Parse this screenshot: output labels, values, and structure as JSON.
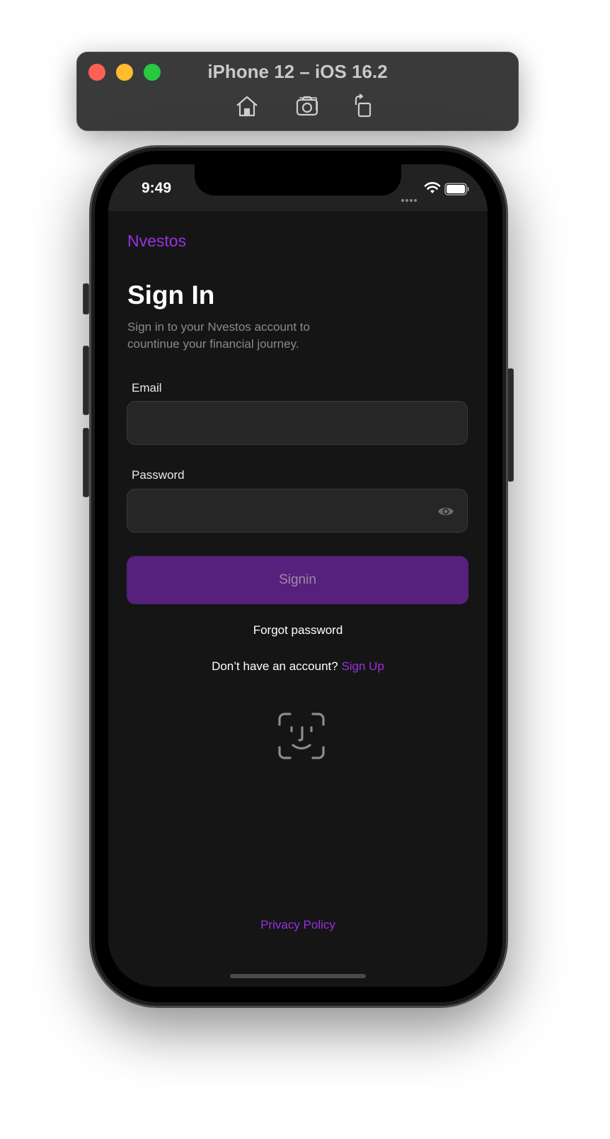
{
  "simulator": {
    "title": "iPhone 12 – iOS 16.2",
    "toolbar_icons": [
      "home-icon",
      "screenshot-icon",
      "rotate-icon"
    ]
  },
  "status_bar": {
    "time": "9:49",
    "icons": [
      "signal-dots-icon",
      "wifi-icon",
      "battery-icon"
    ]
  },
  "app": {
    "brand": "Nvestos",
    "title": "Sign In",
    "subtitle": "Sign in to your Nvestos account to countinue your financial journey.",
    "email": {
      "label": "Email",
      "value": "",
      "placeholder": ""
    },
    "password": {
      "label": "Password",
      "value": "",
      "placeholder": ""
    },
    "signin_label": "Signin",
    "forgot_label": "Forgot password",
    "signup_prompt": "Don’t have an account?",
    "signup_link": "Sign Up",
    "faceid_icon": "face-id-icon",
    "privacy_label": "Privacy Policy"
  },
  "colors": {
    "accent": "#9b30e0",
    "button": "#57207c",
    "background": "#151515",
    "field": "#262626"
  }
}
